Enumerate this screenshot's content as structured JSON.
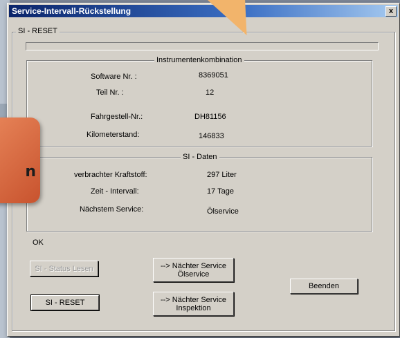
{
  "window": {
    "title": "Service-Intervall-Rückstellung",
    "close_label": "x"
  },
  "callout": {
    "text": "n"
  },
  "group_main": {
    "label": "SI - RESET"
  },
  "group_instr": {
    "label": "Instrumentenkombination",
    "rows": [
      {
        "label": "Software  Nr. :",
        "value": "8369051"
      },
      {
        "label": "Teil  Nr.     :",
        "value": "12"
      },
      {
        "label": "Fahrgestell-Nr.:",
        "value": "DH81156"
      },
      {
        "label": "Kilometerstand:",
        "value": "146833"
      }
    ]
  },
  "group_si": {
    "label": "SI - Daten",
    "rows": [
      {
        "label": "verbrachter Kraftstoff:",
        "value": "297 Liter"
      },
      {
        "label": "Zeit - Intervall:",
        "value": "17 Tage"
      },
      {
        "label": "Nächstem Service:",
        "value": "Ölservice"
      }
    ]
  },
  "status": {
    "text": "OK"
  },
  "buttons": {
    "si_status_lesen": "SI - Status Lesen",
    "si_reset": "SI - RESET",
    "next_oil_line1": "--> Nächter Service",
    "next_oil_line2": "Ölservice",
    "next_insp_line1": "--> Nächter Service",
    "next_insp_line2": "Inspektion",
    "beenden": "Beenden"
  }
}
